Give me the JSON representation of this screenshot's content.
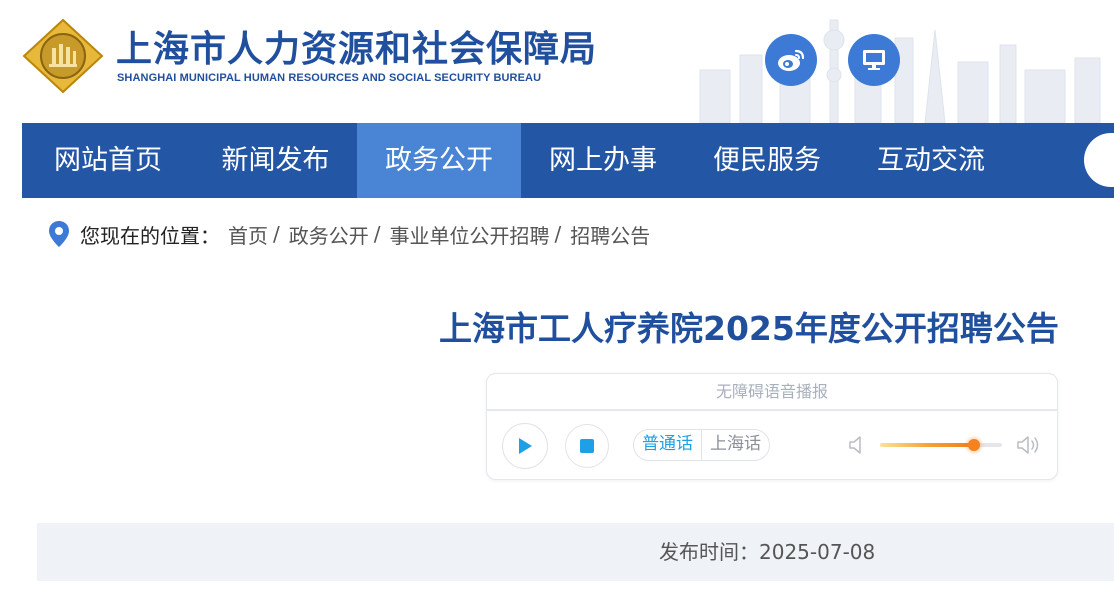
{
  "header": {
    "title": "上海市人力资源和社会保障局",
    "subtitle": "SHANGHAI MUNICIPAL HUMAN RESOURCES AND SOCIAL SECURITY BUREAU",
    "buttons": [
      {
        "icon": "weibo-icon"
      },
      {
        "icon": "desktop-icon"
      }
    ]
  },
  "nav": {
    "items": [
      {
        "label": "网站首页"
      },
      {
        "label": "新闻发布"
      },
      {
        "label": "政务公开",
        "active": true
      },
      {
        "label": "网上办事"
      },
      {
        "label": "便民服务"
      },
      {
        "label": "互动交流"
      }
    ]
  },
  "breadcrumb": {
    "prefix": "您现在的位置：",
    "items": [
      "首页",
      "政务公开",
      "事业单位公开招聘",
      "招聘公告"
    ],
    "separator": "/"
  },
  "article": {
    "title": "上海市工人疗养院2025年度公开招聘公告",
    "publish_label": "发布时间：",
    "publish_date": "2025-07-08"
  },
  "player": {
    "header": "无障碍语音播报",
    "dialects": [
      "普通话",
      "上海话"
    ],
    "selected_dialect": "普通话",
    "volume": 0.77
  },
  "colors": {
    "brand_blue": "#1f4f9d",
    "nav_bg": "#2456a6",
    "nav_active": "#4a84d4",
    "accent_cyan": "#1ea0e6",
    "volume_orange": "#f5821f"
  }
}
